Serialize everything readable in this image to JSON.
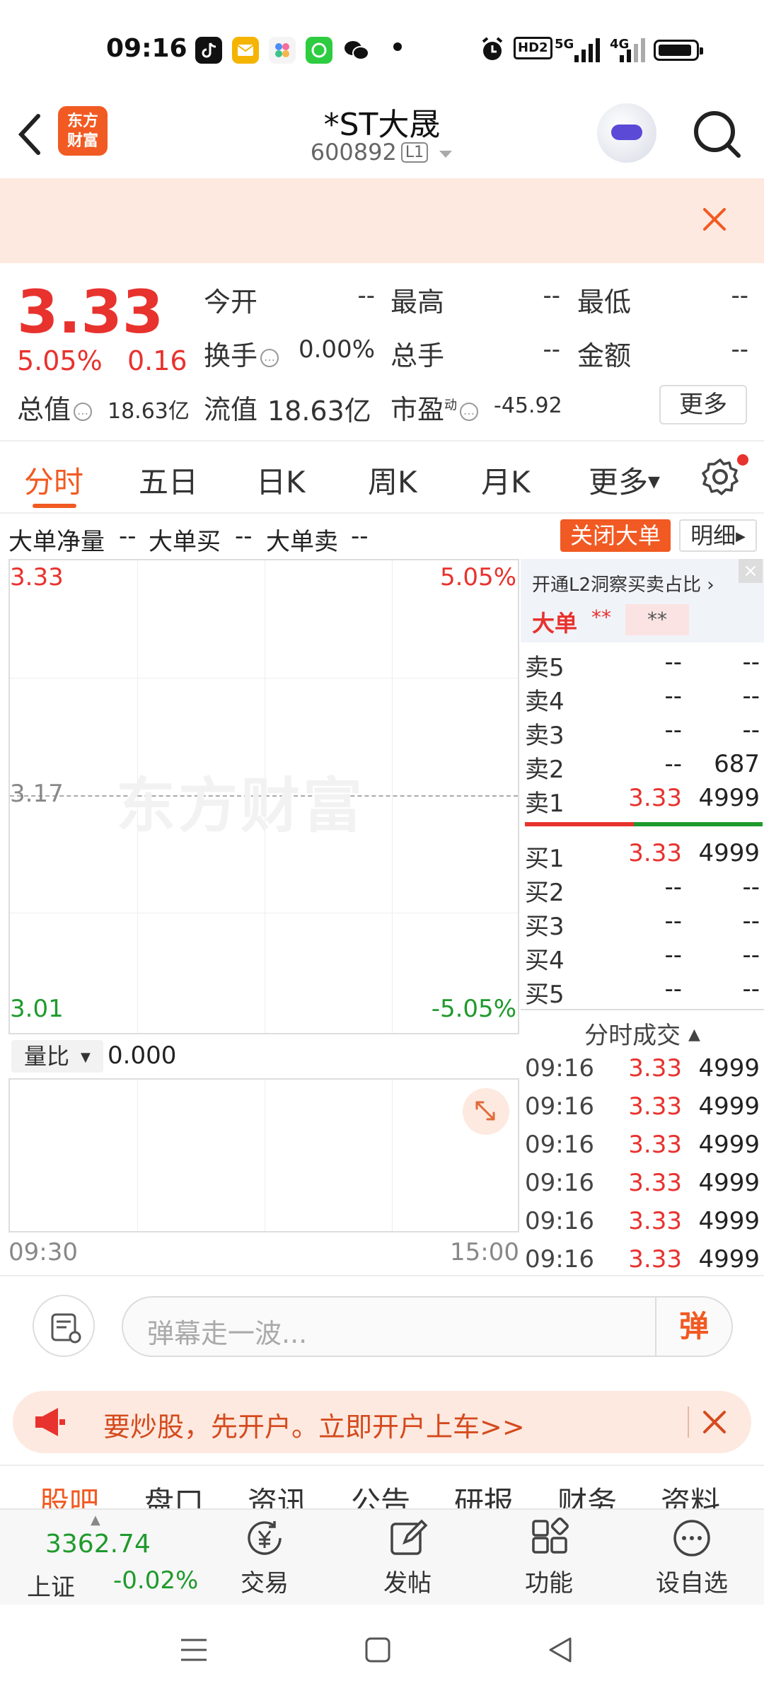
{
  "status": {
    "time": "09:16",
    "hd": "HD2",
    "net1": "5G",
    "net2": "4G"
  },
  "header": {
    "logo_line1": "东方",
    "logo_line2": "财富",
    "stock_name": "*ST大晟",
    "stock_code": "600892",
    "level": "L1"
  },
  "quote": {
    "price": "3.33",
    "pct": "5.05%",
    "change": "0.16",
    "open_label": "今开",
    "open_value": "--",
    "high_label": "最高",
    "high_value": "--",
    "low_label": "最低",
    "low_value": "--",
    "turnover_label": "换手",
    "turnover_value": "0.00%",
    "total_hands_label": "总手",
    "total_hands_value": "--",
    "amount_label": "金额",
    "amount_value": "--",
    "total_value_label": "总值",
    "total_value": "18.63亿",
    "float_value_label": "流值",
    "float_value": "18.63亿",
    "pe_label": "市盈",
    "pe_sup": "动",
    "pe_value": "-45.92",
    "more_label": "更多"
  },
  "tabs": [
    "分时",
    "五日",
    "日K",
    "周K",
    "月K",
    "更多"
  ],
  "bigorder": {
    "net_label": "大单净量",
    "net_value": "--",
    "buy_label": "大单买",
    "buy_value": "--",
    "sell_label": "大单卖",
    "sell_value": "--",
    "close_btn": "关闭大单",
    "detail_btn": "明细"
  },
  "chart": {
    "top_price": "3.33",
    "top_pct": "5.05%",
    "mid_price": "3.17",
    "bottom_price": "3.01",
    "bottom_pct": "-5.05%",
    "watermark": "东方财富"
  },
  "volume": {
    "selector": "量比",
    "value": "0.000",
    "start_time": "09:30",
    "end_time": "15:00"
  },
  "book": {
    "title": "开通L2洞察买卖占比",
    "big_label": "大单",
    "big_v1": "**",
    "big_v2": "**",
    "asks": [
      {
        "label": "卖5",
        "price": "--",
        "vol": "--"
      },
      {
        "label": "卖4",
        "price": "--",
        "vol": "--"
      },
      {
        "label": "卖3",
        "price": "--",
        "vol": "--"
      },
      {
        "label": "卖2",
        "price": "--",
        "vol": "687"
      },
      {
        "label": "卖1",
        "price": "3.33",
        "vol": "4999"
      }
    ],
    "bids": [
      {
        "label": "买1",
        "price": "3.33",
        "vol": "4999"
      },
      {
        "label": "买2",
        "price": "--",
        "vol": "--"
      },
      {
        "label": "买3",
        "price": "--",
        "vol": "--"
      },
      {
        "label": "买4",
        "price": "--",
        "vol": "--"
      },
      {
        "label": "买5",
        "price": "--",
        "vol": "--"
      }
    ],
    "trades_title": "分时成交",
    "trades": [
      {
        "time": "09:16",
        "price": "3.33",
        "vol": "4999"
      },
      {
        "time": "09:16",
        "price": "3.33",
        "vol": "4999"
      },
      {
        "time": "09:16",
        "price": "3.33",
        "vol": "4999"
      },
      {
        "time": "09:16",
        "price": "3.33",
        "vol": "4999"
      },
      {
        "time": "09:16",
        "price": "3.33",
        "vol": "4999"
      },
      {
        "time": "09:16",
        "price": "3.33",
        "vol": "4999"
      }
    ]
  },
  "danmaku": {
    "placeholder": "弹幕走一波...",
    "btn": "弹"
  },
  "promo": {
    "text": "要炒股，先开户。立即开户上车>>"
  },
  "sections": [
    "股吧",
    "盘口",
    "资讯",
    "公告",
    "研报",
    "财务",
    "资料"
  ],
  "bottom": {
    "index_value": "3362.74",
    "index_name": "上证",
    "index_change": "-0.02%",
    "items": [
      "交易",
      "发帖",
      "功能",
      "设自选"
    ]
  },
  "colors": {
    "accent": "#f15a22",
    "up": "#e8322e",
    "down": "#1f9a2c"
  }
}
